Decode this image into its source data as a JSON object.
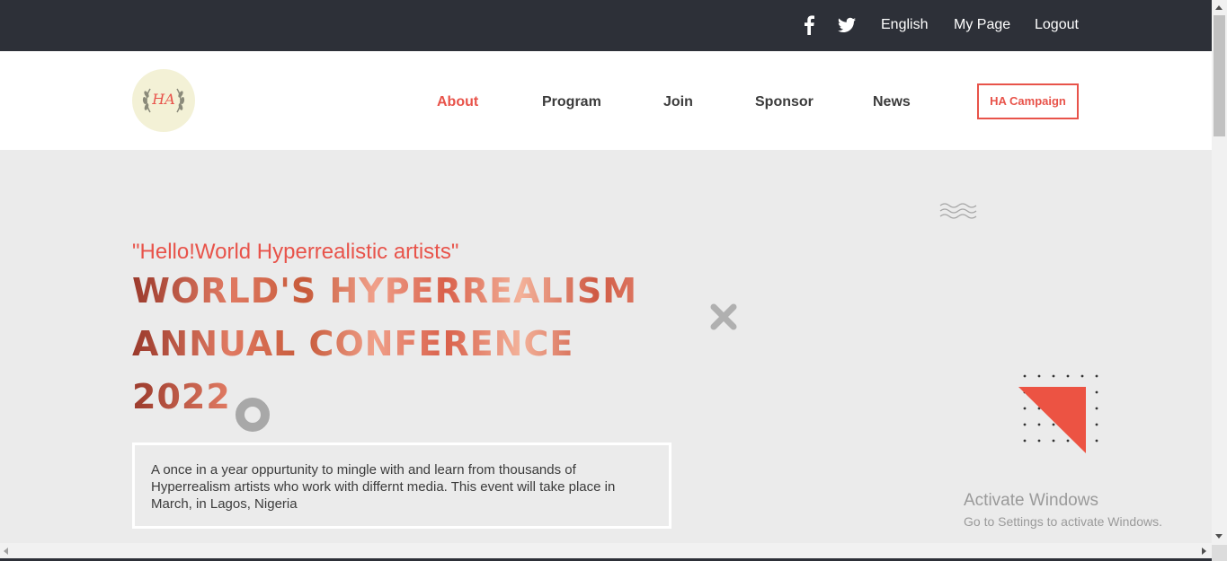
{
  "topbar": {
    "facebook_icon": "facebook-icon",
    "twitter_icon": "twitter-icon",
    "language": "English",
    "my_page": "My Page",
    "logout": "Logout"
  },
  "header": {
    "logo_text": "HA",
    "nav": {
      "about": "About",
      "program": "Program",
      "join": "Join",
      "sponsor": "Sponsor",
      "news": "News"
    },
    "campaign_button": "HA Campaign"
  },
  "hero": {
    "subtitle": "\"Hello!World Hyperrealistic artists\"",
    "headline_line1": "WORLD'S HYPERREALISM",
    "headline_line2": "ANNUAL CONFERENCE",
    "headline_line3": "2022",
    "description": "A once in a year oppurtunity to mingle with and learn from thousands of Hyperrealism artists who work with differnt media. This event will take place in March, in Lagos, Nigeria"
  },
  "watermark": {
    "title": "Activate Windows",
    "subtitle": "Go to Settings to activate Windows."
  },
  "colors": {
    "accent": "#e8534a",
    "topbar_bg": "#2d3038",
    "hero_bg": "#ebebeb"
  }
}
